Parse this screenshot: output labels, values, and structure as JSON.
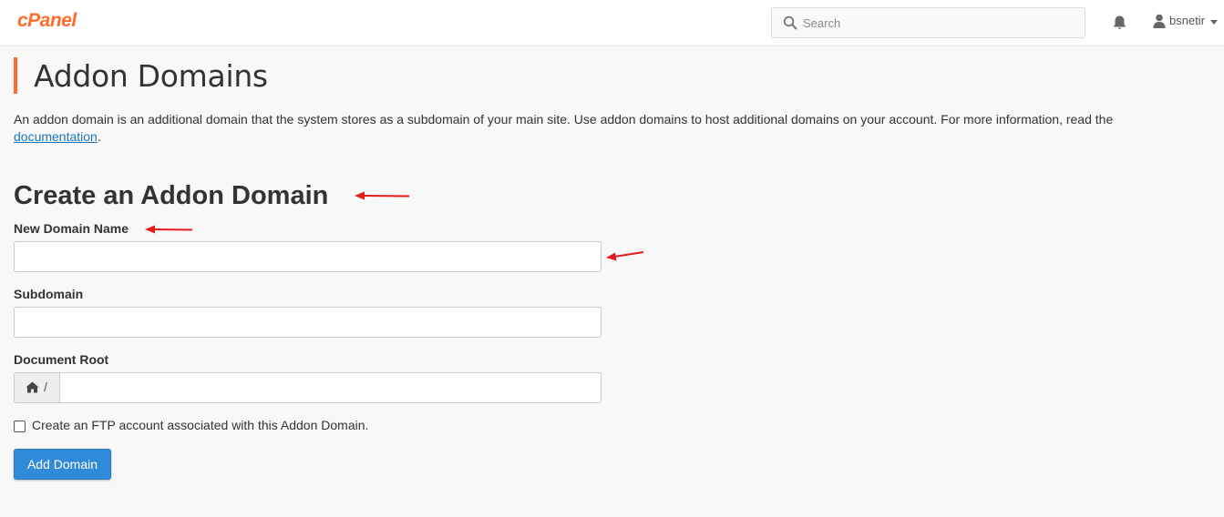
{
  "header": {
    "logo": "cPanel",
    "search": {
      "placeholder": "Search",
      "value": ""
    },
    "user": {
      "name": "bsnetir"
    }
  },
  "page": {
    "title": "Addon Domains",
    "intro_text": "An addon domain is an additional domain that the system stores as a subdomain of your main site. Use addon domains to host additional domains on your account. For more information, read the ",
    "intro_link": "documentation",
    "intro_end": "."
  },
  "form": {
    "section_title": "Create an Addon Domain",
    "new_domain_label": "New Domain Name",
    "new_domain_value": "",
    "subdomain_label": "Subdomain",
    "subdomain_value": "",
    "document_root_label": "Document Root",
    "document_root_prefix": "/",
    "document_root_value": "",
    "ftp_checkbox_label": "Create an FTP account associated with this Addon Domain.",
    "ftp_checked": false,
    "submit_label": "Add Domain"
  },
  "colors": {
    "brand_orange": "#ff6c2c",
    "button_blue": "#2f8bd7",
    "link_blue": "#1b75bb",
    "annotation_red": "#e41b1b"
  },
  "icons": [
    "search-icon",
    "bell-icon",
    "user-icon",
    "caret-down-icon",
    "home-icon",
    "arrow-annotation"
  ]
}
